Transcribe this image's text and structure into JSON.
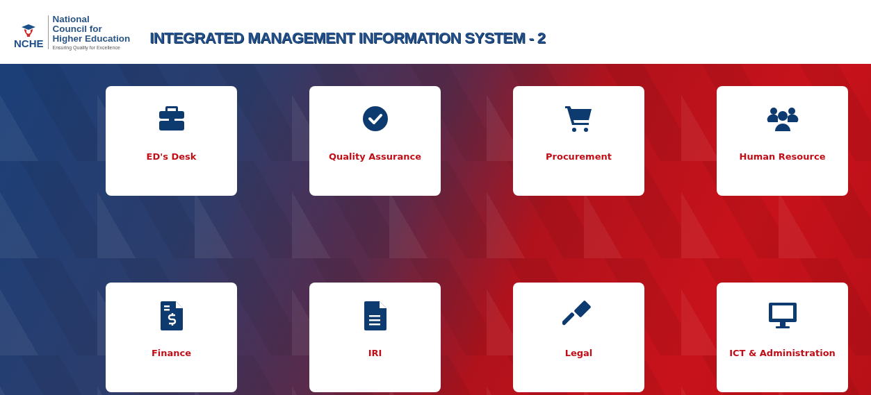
{
  "logo": {
    "acronym": "NCHE",
    "name_lines": [
      "National",
      "Council for",
      "Higher Education"
    ],
    "tagline": "Ensuring Quality for Excellence"
  },
  "title": "INTEGRATED MANAGEMENT INFORMATION SYSTEM - 2",
  "modules": [
    {
      "label": "ED's Desk",
      "kind": "briefcase"
    },
    {
      "label": "Quality Assurance",
      "kind": "check"
    },
    {
      "label": "Procurement",
      "kind": "cart"
    },
    {
      "label": "Human Resource",
      "kind": "users"
    },
    {
      "label": "Finance",
      "kind": "invoice"
    },
    {
      "label": "IRI",
      "kind": "document"
    },
    {
      "label": "Legal",
      "kind": "gavel"
    },
    {
      "label": "ICT & Administration",
      "kind": "monitor"
    }
  ]
}
